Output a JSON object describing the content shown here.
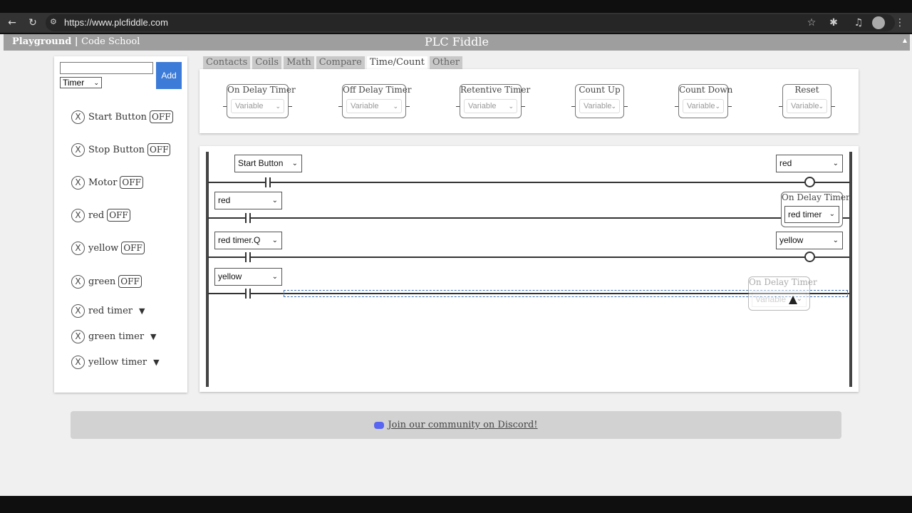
{
  "browser": {
    "url": "https://www.plcfiddle.com"
  },
  "nav": {
    "playground": "Playground",
    "separator": " | ",
    "code_school": "Code School",
    "title": "PLC Fiddle"
  },
  "sidebar": {
    "name_input_value": "",
    "type_select": "Timer",
    "add_label": "Add",
    "variables": [
      {
        "remove": "X",
        "name": "Start Button",
        "state": "OFF"
      },
      {
        "remove": "X",
        "name": "Stop Button",
        "state": "OFF"
      },
      {
        "remove": "X",
        "name": "Motor",
        "state": "OFF"
      },
      {
        "remove": "X",
        "name": "red",
        "state": "OFF"
      },
      {
        "remove": "X",
        "name": "yellow",
        "state": "OFF"
      },
      {
        "remove": "X",
        "name": "green",
        "state": "OFF"
      }
    ],
    "timers": [
      {
        "remove": "X",
        "name": "red timer",
        "expand_icon": "triangle-down-icon"
      },
      {
        "remove": "X",
        "name": "green timer",
        "expand_icon": "triangle-down-icon"
      },
      {
        "remove": "X",
        "name": "yellow timer",
        "expand_icon": "triangle-down-icon"
      }
    ]
  },
  "tabs": [
    "Contacts",
    "Coils",
    "Math",
    "Compare",
    "Time/Count",
    "Other"
  ],
  "active_tab": "Time/Count",
  "palette": {
    "blocks": [
      {
        "label": "On Delay Timer",
        "placeholder": "Variable"
      },
      {
        "label": "Off Delay Timer",
        "placeholder": "Variable"
      },
      {
        "label": "Retentive Timer",
        "placeholder": "Variable"
      },
      {
        "label": "Count Up",
        "placeholder": "Variable"
      },
      {
        "label": "Count Down",
        "placeholder": "Variable"
      },
      {
        "label": "Reset",
        "placeholder": "Variable"
      }
    ]
  },
  "ladder": {
    "rungs": [
      {
        "contact": "Start Button",
        "output_type": "coil",
        "output": "red"
      },
      {
        "contact": "red",
        "output_type": "timer",
        "output_label": "On Delay Timer",
        "output": "red timer"
      },
      {
        "contact": "red timer.Q",
        "output_type": "coil",
        "output": "yellow"
      },
      {
        "contact": "yellow",
        "output_type": "drop-target"
      }
    ],
    "dragging": {
      "label": "On Delay Timer",
      "placeholder": "Variable"
    }
  },
  "footer": {
    "discord_text": "Join our community on Discord!"
  },
  "colors": {
    "accent": "#3d7bd8",
    "nav_bg": "#9e9e9e",
    "page_bg": "#f0f0f0",
    "drop_outline": "#3a6fb0"
  }
}
